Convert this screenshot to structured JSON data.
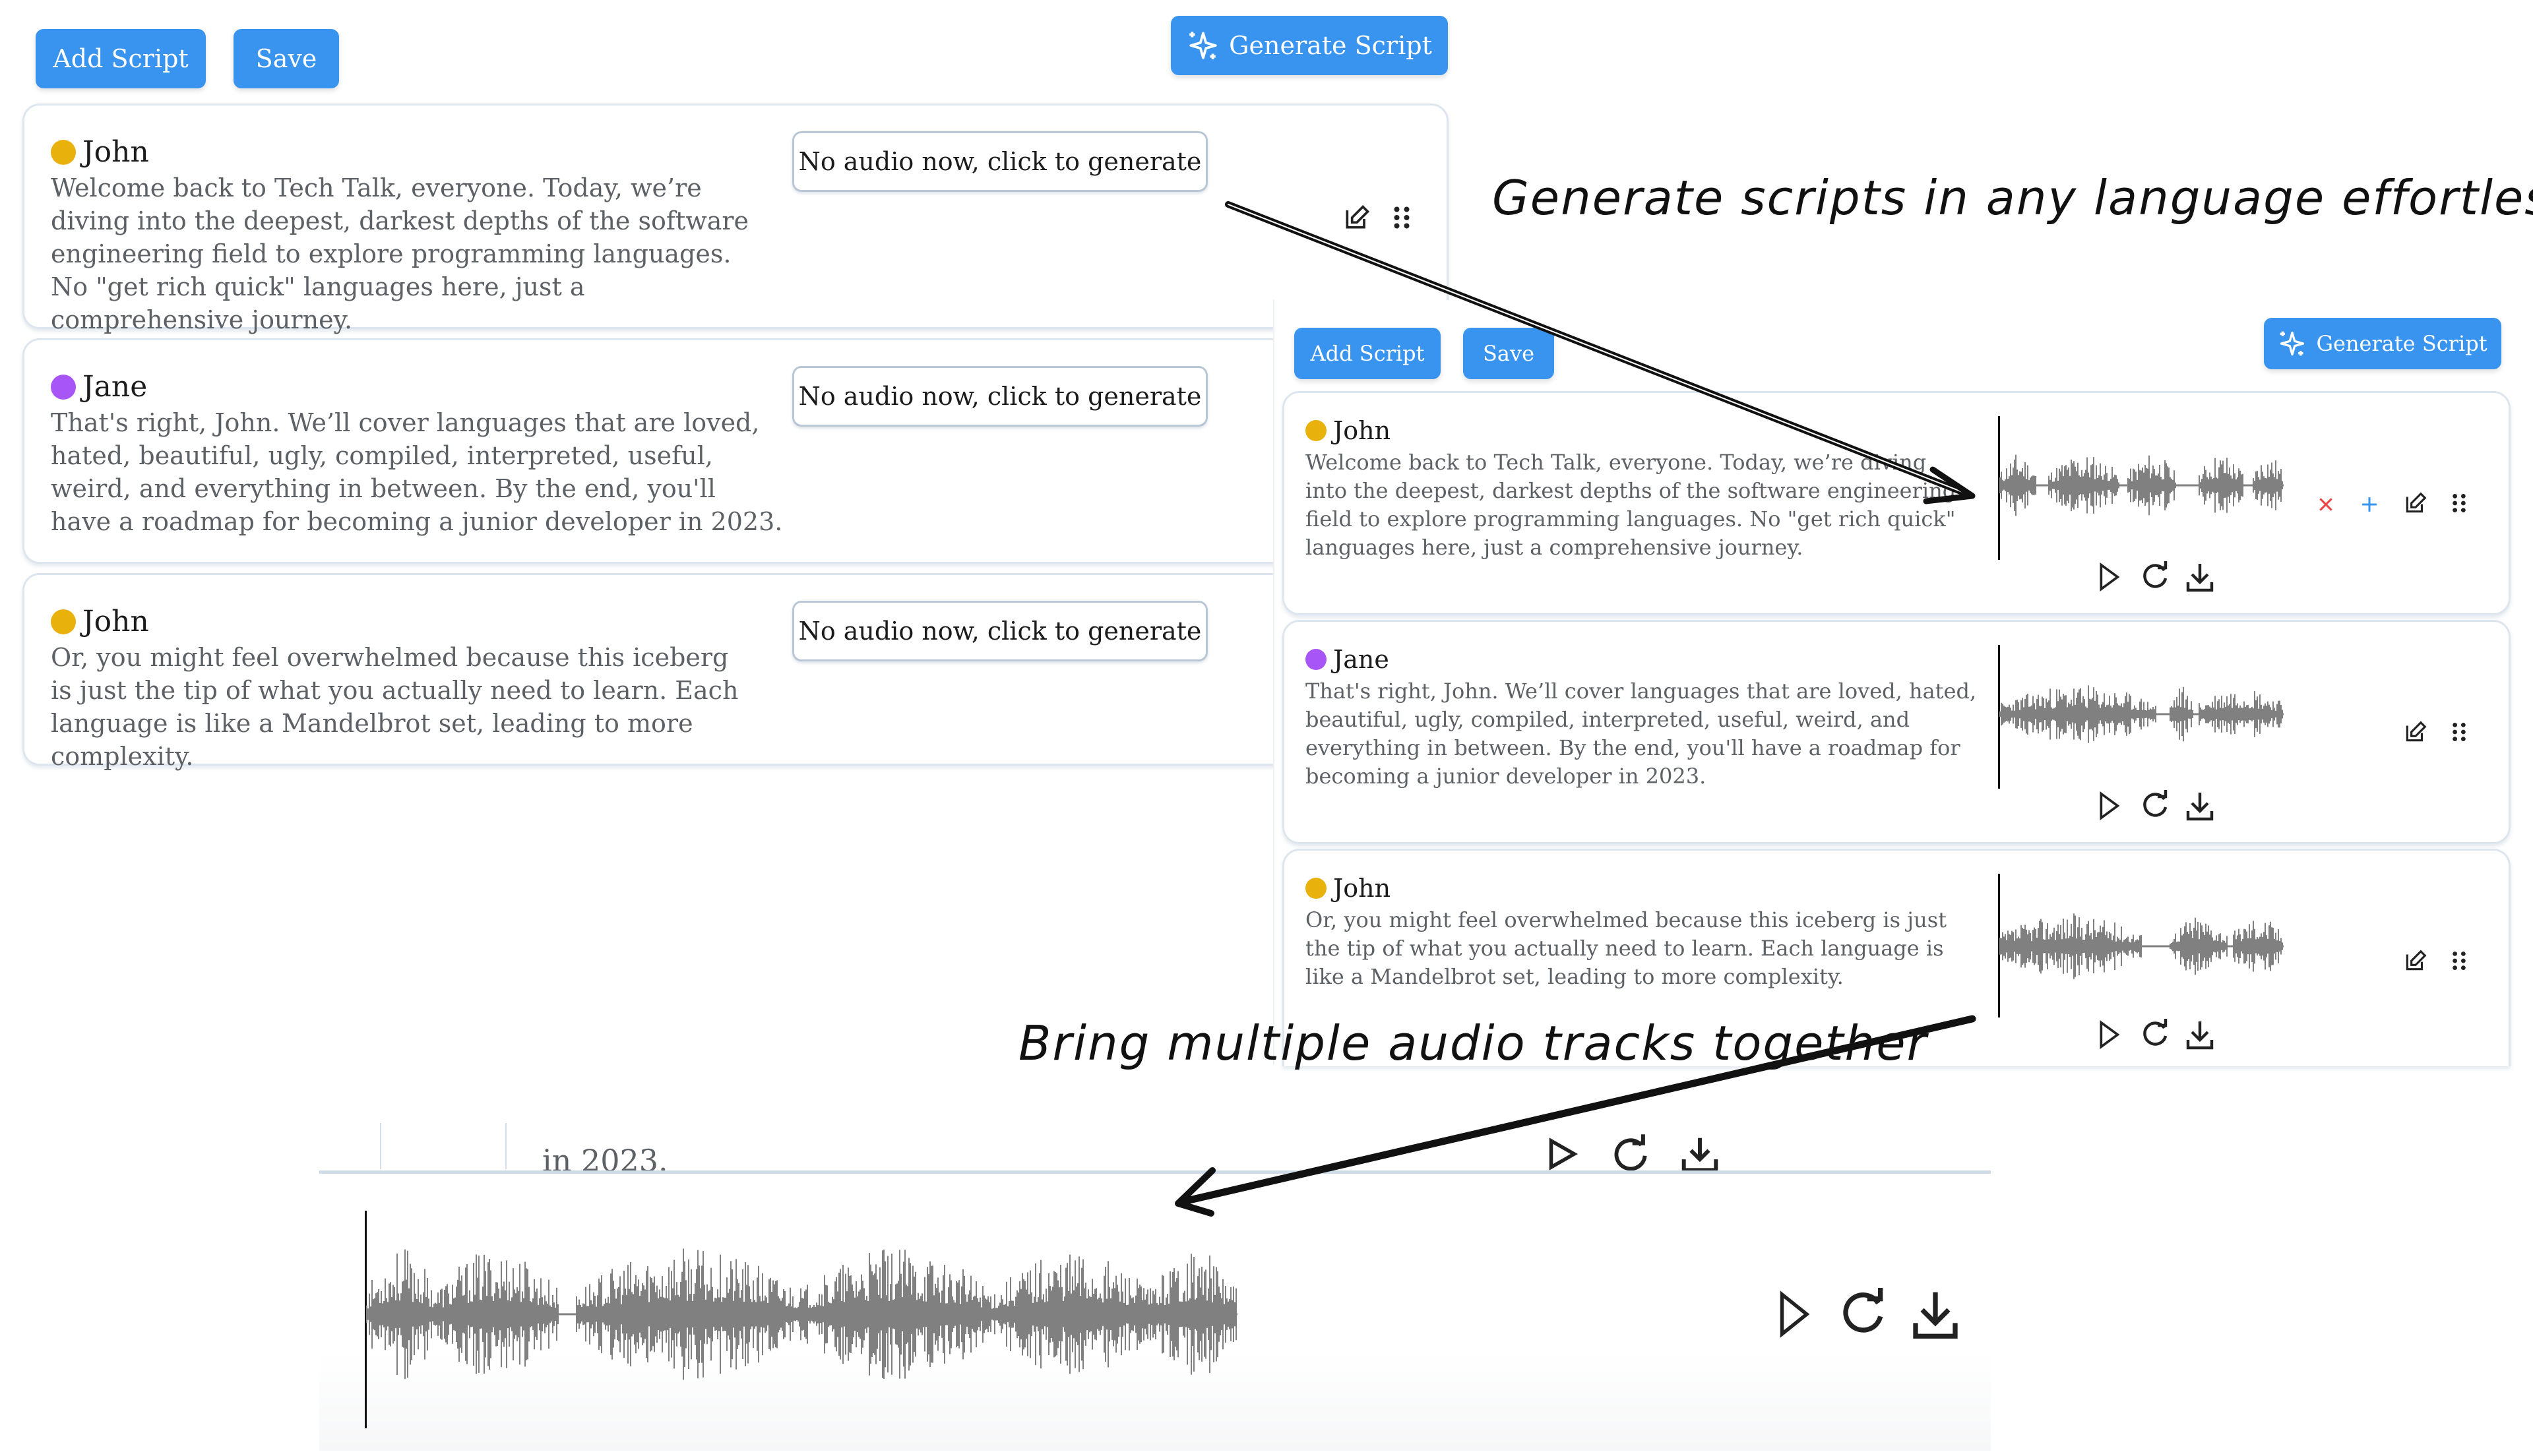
{
  "accent_color": "#3894ee",
  "annotations": {
    "top": "Generate scripts in any language effortlessly",
    "bottom": "Bring multiple audio tracks together"
  },
  "left_panel": {
    "toolbar": {
      "add_script": "Add Script",
      "save": "Save",
      "generate_script": "Generate Script"
    },
    "cards": [
      {
        "speaker": "John",
        "speaker_color": "#e8b10c",
        "text": "Welcome back to Tech Talk, everyone. Today, we’re diving into the deepest, darkest depths of the software engineering field to explore programming languages. No \"get rich quick\" languages here, just a comprehensive journey.",
        "audio_button": "No audio now, click to generate"
      },
      {
        "speaker": "Jane",
        "speaker_color": "#a855f7",
        "text": "That's right, John. We’ll cover languages that are loved, hated, beautiful, ugly, compiled, interpreted, useful, weird, and everything in between. By the end, you'll have a roadmap for becoming a junior developer in 2023.",
        "audio_button": "No audio now, click to generate"
      },
      {
        "speaker": "John",
        "speaker_color": "#e8b10c",
        "text": "Or, you might feel overwhelmed because this iceberg is just the tip of what you actually need to learn. Each language is like a Mandelbrot set, leading to more complexity.",
        "audio_button": "No audio now, click to generate"
      }
    ]
  },
  "right_panel": {
    "toolbar": {
      "add_script": "Add Script",
      "save": "Save",
      "generate_script": "Generate Script"
    },
    "cards": [
      {
        "speaker": "John",
        "speaker_color": "#e8b10c",
        "text": "Welcome back to Tech Talk, everyone. Today, we’re diving into the deepest, darkest depths of the software engineering field to explore programming languages. No \"get rich quick\" languages here, just a comprehensive journey.",
        "has_confirm_actions": true
      },
      {
        "speaker": "Jane",
        "speaker_color": "#a855f7",
        "text": "That's right, John. We’ll cover languages that are loved, hated, beautiful, ugly, compiled, interpreted, useful, weird, and everything in between. By the end, you'll have a roadmap for becoming a junior developer in 2023.",
        "has_confirm_actions": false
      },
      {
        "speaker": "John",
        "speaker_color": "#e8b10c",
        "text": "Or, you might feel overwhelmed because this iceberg is just the tip of what you actually need to learn. Each language is like a Mandelbrot set, leading to more complexity.",
        "has_confirm_actions": false
      }
    ]
  },
  "bottom_panel": {
    "partial_text": "in 2023.",
    "merged_track": "combined audio track"
  },
  "colors": {
    "delete": "#ef4444",
    "add": "#3894ee",
    "waveform": "#808080"
  }
}
